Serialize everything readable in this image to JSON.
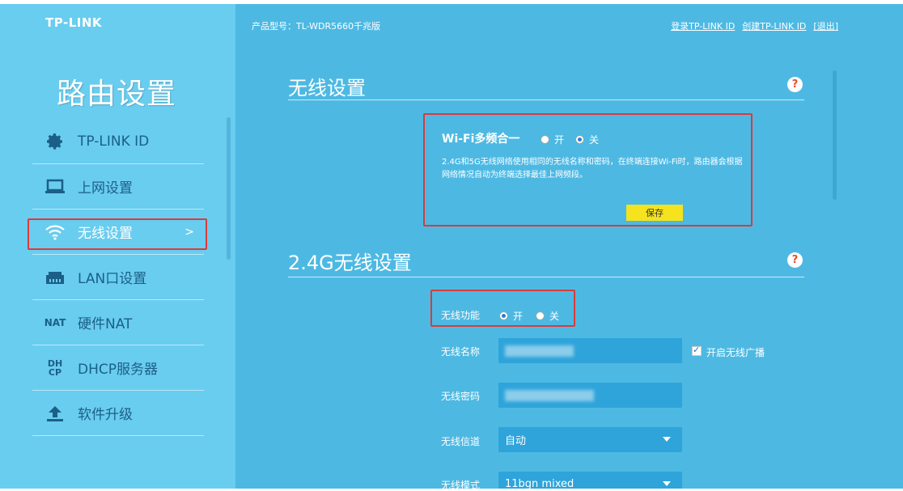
{
  "sidebar": {
    "logo": "TP-LINK",
    "title": "路由设置",
    "items": [
      {
        "label": "TP-LINK ID",
        "icon": "gear-icon"
      },
      {
        "label": "上网设置",
        "icon": "laptop-icon"
      },
      {
        "label": "无线设置",
        "icon": "wifi-icon",
        "active": true,
        "arrow": ">"
      },
      {
        "label": "LAN口设置",
        "icon": "lan-port-icon"
      },
      {
        "label": "硬件NAT",
        "icon": "nat-icon",
        "icon_text": "NAT"
      },
      {
        "label": "DHCP服务器",
        "icon": "dhcp-icon",
        "icon_text": "DH CP"
      },
      {
        "label": "软件升级",
        "icon": "upload-icon"
      }
    ]
  },
  "header": {
    "model": "产品型号：TL-WDR5660千兆版",
    "links": [
      "登录TP-LINK ID",
      "创建TP-LINK ID",
      "[退出]"
    ]
  },
  "wireless": {
    "title": "无线设置",
    "help": "?",
    "multiband": {
      "title": "Wi-Fi多频合一",
      "on": "开",
      "off": "关",
      "selected": "off",
      "description": "2.4G和5G无线网络使用相同的无线名称和密码，在终端连接Wi-Fi时，路由器会根据网络情况自动为终端选择最佳上网频段。",
      "save": "保存"
    }
  },
  "band24": {
    "title": "2.4G无线设置",
    "help": "?",
    "function_label": "无线功能",
    "function_on": "开",
    "function_off": "关",
    "function_selected": "on",
    "ssid_label": "无线名称",
    "broadcast_label": "开启无线广播",
    "broadcast_checked": true,
    "password_label": "无线密码",
    "channel_label": "无线信道",
    "channel_value": "自动",
    "mode_label": "无线模式",
    "mode_value": "11bgn mixed"
  },
  "colors": {
    "sidebar_bg": "#69cdef",
    "main_bg": "#4db9e3",
    "field_bg": "#2ea4da",
    "highlight": "#d93b3b",
    "save_btn": "#f5e31e"
  }
}
